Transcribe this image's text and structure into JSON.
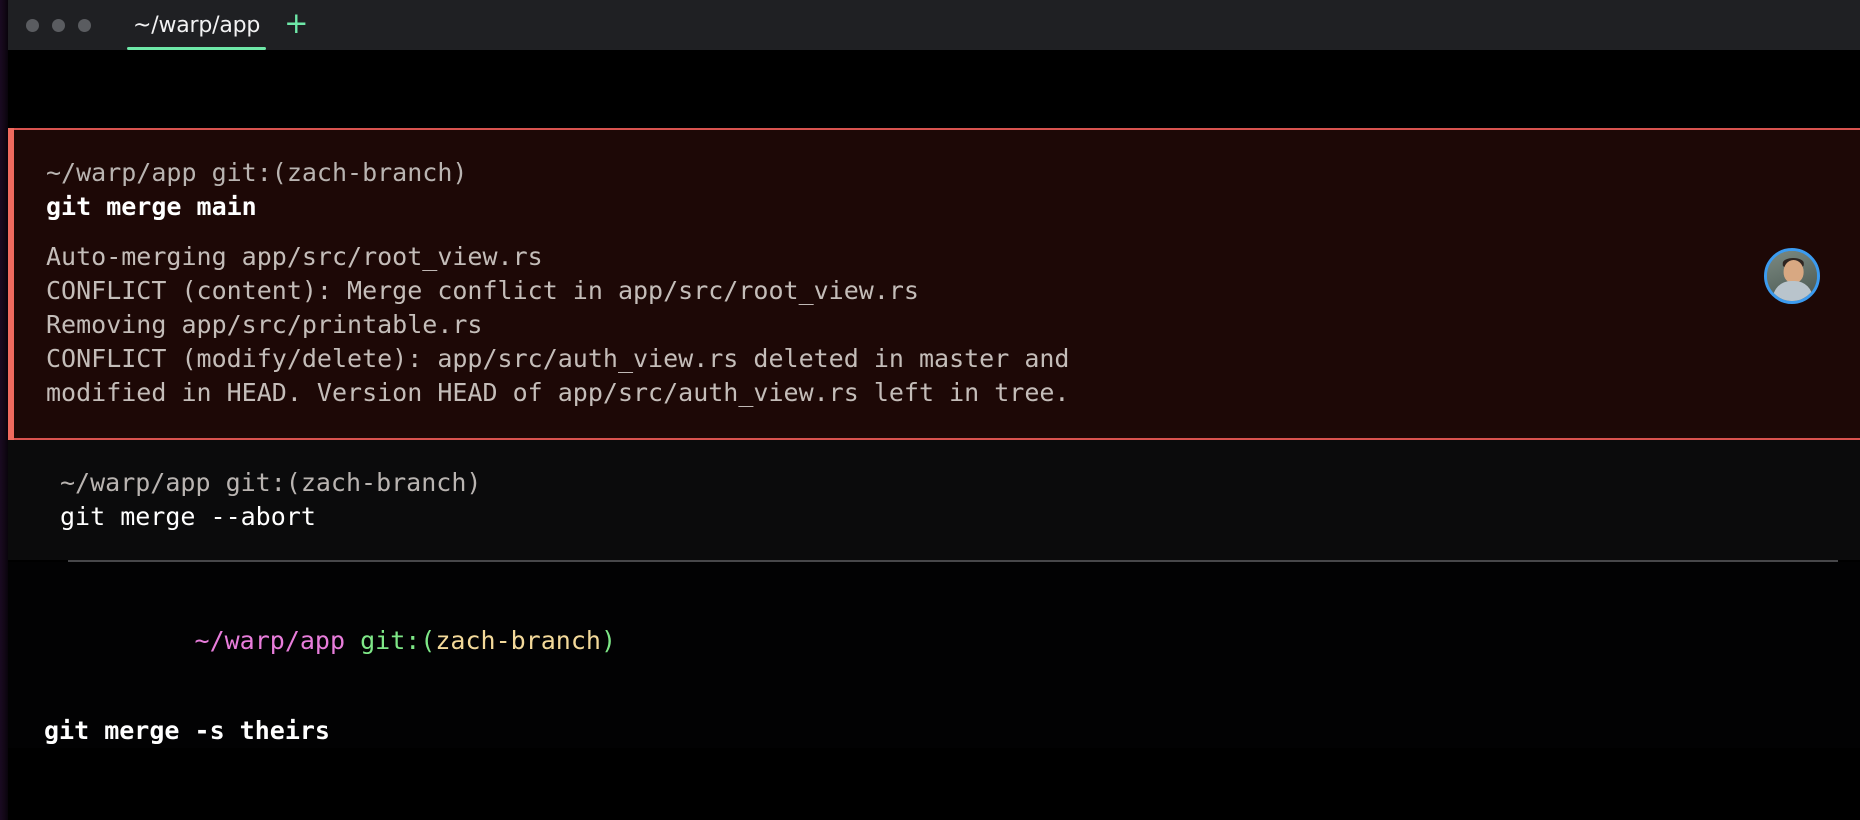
{
  "window": {
    "traffic_lights": [
      "close",
      "minimize",
      "maximize"
    ],
    "accent_green": "#6ee8a8",
    "titlebar_bg": "#1f2023"
  },
  "tabs": [
    {
      "label": "~/warp/app",
      "active": true
    }
  ],
  "new_tab": {
    "label": "+",
    "icon": "plus-icon"
  },
  "blocks": [
    {
      "id": "block-merge-main",
      "status": "error",
      "accent_color": "#ef6a5e",
      "background": "#1d0806",
      "prompt": "~/warp/app git:(zach-branch)",
      "command": "git merge main",
      "output": [
        "Auto-merging app/src/root_view.rs",
        "CONFLICT (content): Merge conflict in app/src/root_view.rs",
        "Removing app/src/printable.rs",
        "CONFLICT (modify/delete): app/src/auth_view.rs deleted in master and",
        "modified in HEAD. Version HEAD of app/src/auth_view.rs left in tree."
      ]
    },
    {
      "id": "block-merge-abort",
      "status": "plain",
      "background": "#0b0b0c",
      "prompt": "~/warp/app git:(zach-branch)",
      "command": "git merge --abort",
      "output": []
    },
    {
      "id": "block-merge-theirs",
      "status": "active",
      "background": "#020203",
      "prompt_parts": {
        "path": "~/warp/app ",
        "git": "git:(",
        "branch": "zach-branch",
        "close": ")"
      },
      "command": "git merge -s theirs",
      "output": []
    }
  ],
  "avatar": {
    "name": "collaborator-avatar",
    "ring_color": "#3b9bf0"
  },
  "colors": {
    "prompt_dim": "#b9b4b1",
    "command_text": "#ffffff",
    "output_text": "#c4bdb9",
    "prompt_path": "#e87ddb",
    "prompt_git": "#7ee787",
    "prompt_branch": "#f3d99a",
    "divider": "#47474a"
  }
}
